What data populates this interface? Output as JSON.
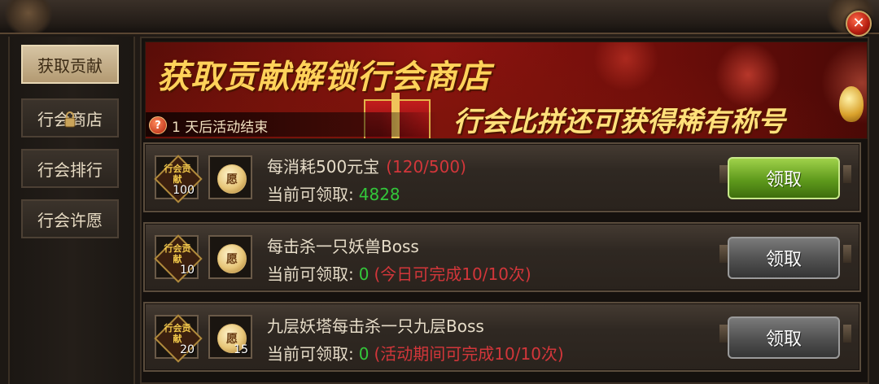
{
  "window": {
    "close_glyph": "✕"
  },
  "sidebar": {
    "items": [
      {
        "label": "获取贡献",
        "active": true
      },
      {
        "label": "行会商店",
        "locked": true
      },
      {
        "label": "行会排行"
      },
      {
        "label": "行会许愿"
      }
    ]
  },
  "banner": {
    "title": "获取贡献解锁行会商店",
    "subtitle": "行会比拼还可获得稀有称号",
    "help_glyph": "?",
    "end_notice": "1 天后活动结束"
  },
  "tasks": [
    {
      "title": "每消耗500元宝",
      "progress": "(120/500)",
      "claim_label": "当前可领取:",
      "claim_value": "4828",
      "claim_note": "",
      "reward_contrib_count": "100",
      "reward_coin_count": "",
      "button_label": "领取",
      "button_enabled": true
    },
    {
      "title": "每击杀一只妖兽Boss",
      "progress": "",
      "claim_label": "当前可领取:",
      "claim_value": "0",
      "claim_note": "(今日可完成10/10次)",
      "reward_contrib_count": "10",
      "reward_coin_count": "",
      "button_label": "领取",
      "button_enabled": false
    },
    {
      "title": "九层妖塔每击杀一只九层Boss",
      "progress": "",
      "claim_label": "当前可领取:",
      "claim_value": "0",
      "claim_note": "(活动期间可完成10/10次)",
      "reward_contrib_count": "20",
      "reward_coin_count": "15",
      "button_label": "领取",
      "button_enabled": false
    }
  ],
  "icons": {
    "contrib_text": "行会贡献",
    "coin_glyph": "愿"
  },
  "colors": {
    "progress_red": "#d2363a",
    "value_green": "#33c63a",
    "title_gold": "#ffd25a"
  }
}
